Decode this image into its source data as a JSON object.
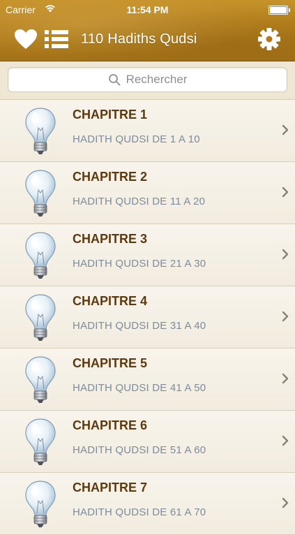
{
  "status_bar": {
    "carrier": "Carrier",
    "time": "11:54 PM"
  },
  "nav": {
    "title": "110 Hadiths Qudsi",
    "left_icons": [
      "heart-icon",
      "list-icon"
    ],
    "right_icon": "gear-icon"
  },
  "search": {
    "placeholder": "Rechercher",
    "icon": "search-icon"
  },
  "colors": {
    "header": "#b8831f",
    "row_title": "#5c3a10",
    "row_subtitle": "#7d8b9c",
    "background": "#f4efe4"
  },
  "chapters": [
    {
      "title": "CHAPITRE 1",
      "subtitle": "HADITH QUDSI DE 1 A 10"
    },
    {
      "title": "CHAPITRE 2",
      "subtitle": "HADITH QUDSI DE 11 A 20"
    },
    {
      "title": "CHAPITRE 3",
      "subtitle": "HADITH QUDSI DE 21 A 30"
    },
    {
      "title": "CHAPITRE 4",
      "subtitle": "HADITH QUDSI DE 31 A 40"
    },
    {
      "title": "CHAPITRE 5",
      "subtitle": "HADITH QUDSI DE 41 A 50"
    },
    {
      "title": "CHAPITRE 6",
      "subtitle": "HADITH QUDSI DE 51 A 60"
    },
    {
      "title": "CHAPITRE 7",
      "subtitle": "HADITH QUDSI DE 61 A 70"
    }
  ]
}
